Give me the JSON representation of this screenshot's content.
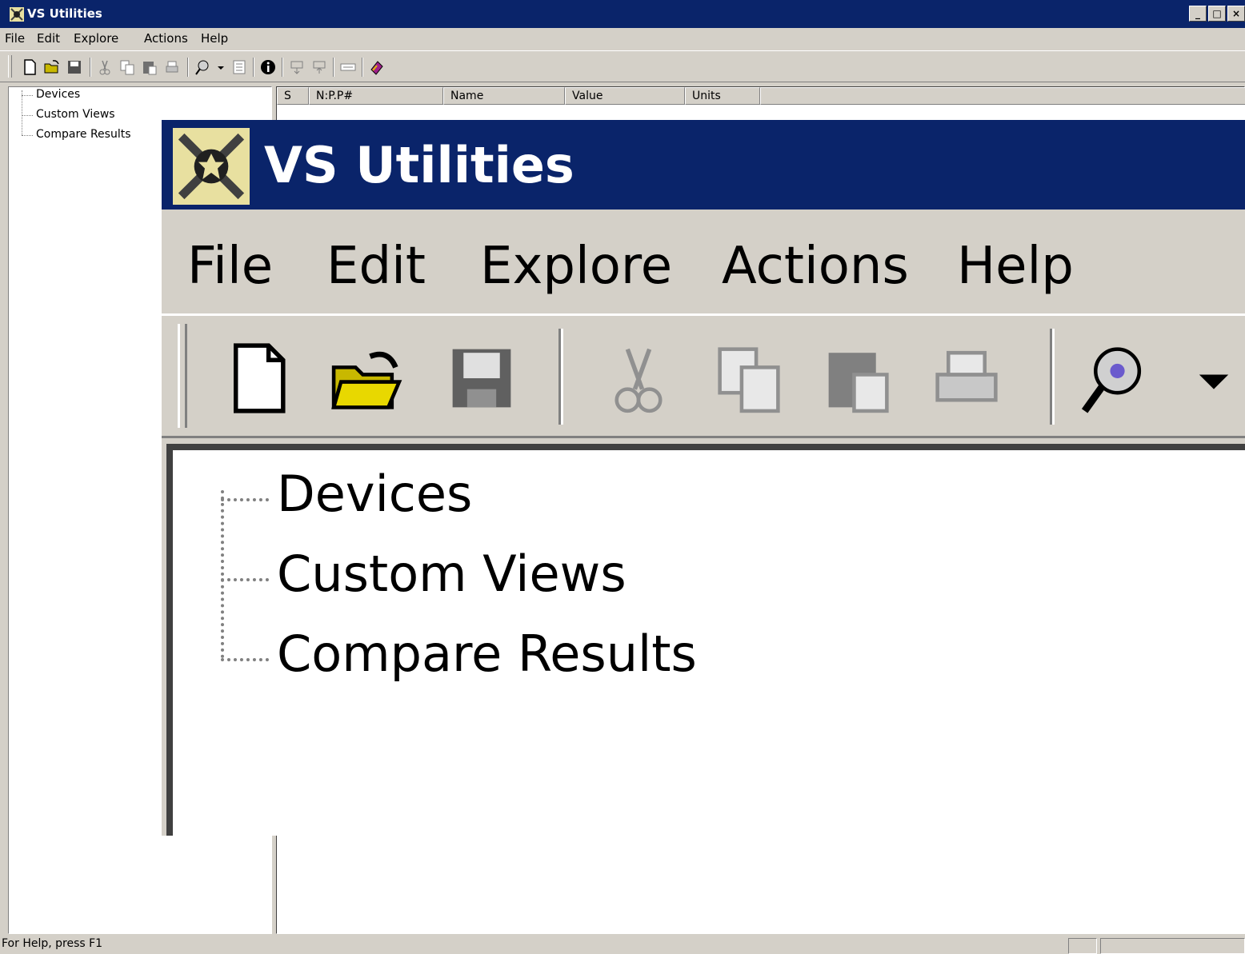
{
  "window": {
    "title": "VS Utilities",
    "controls": [
      "_",
      "□",
      "×"
    ]
  },
  "menu": [
    "File",
    "Edit",
    "Explore",
    "Actions",
    "Help"
  ],
  "toolbar_icons": [
    "new-document-icon",
    "open-folder-icon",
    "save-icon",
    "cut-icon",
    "copy-icon",
    "paste-icon",
    "print-icon",
    "connect-probe-icon",
    "dropdown-arrow-icon",
    "properties-icon",
    "info-icon",
    "download-icon",
    "upload-icon",
    "display-icon",
    "book-icon"
  ],
  "tree": {
    "items": [
      "Devices",
      "Custom Views",
      "Compare Results"
    ]
  },
  "list": {
    "columns": [
      "S",
      "N:P.P#",
      "Name",
      "Value",
      "Units"
    ]
  },
  "statusbar": {
    "text": "For Help, press F1"
  },
  "zoom": {
    "title": "VS Utilities",
    "menu": [
      "File",
      "Edit",
      "Explore",
      "Actions",
      "Help"
    ],
    "tree_items": [
      "Devices",
      "Custom Views",
      "Compare Results"
    ]
  },
  "colors": {
    "titlebar": "#0a246a",
    "face": "#d4d0c8",
    "folder": "#c8b800"
  }
}
